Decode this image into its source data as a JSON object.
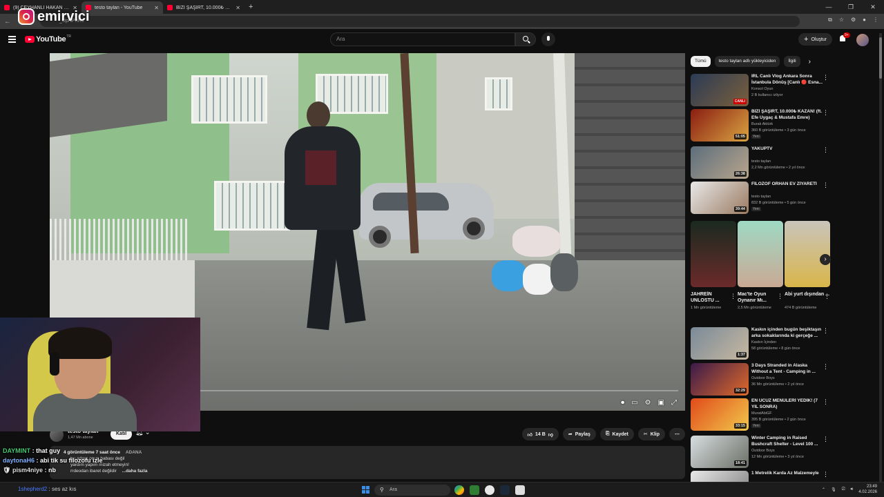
{
  "browser": {
    "tabs": [
      {
        "title": "(9) CEYHANLI HAKAN EV Z"
      },
      {
        "title": "testo taylan - YouTube"
      },
      {
        "title": "BİZİ ŞAŞIRT, 10.000₺ KAZANI"
      }
    ],
    "url": "_UpNPhR0"
  },
  "overlay": {
    "brand": "emirvici"
  },
  "youtube": {
    "logo_text": "YouTube",
    "logo_region": "TR",
    "search_placeholder": "Ara",
    "create_label": "Oluştur",
    "notif_badge": "9+"
  },
  "video": {
    "channel": "testo taylan",
    "subs": "1,47 Mn abone",
    "join": "Katıl",
    "likes": "14 B",
    "share": "Paylaş",
    "save": "Kaydet",
    "clip": "Klip",
    "description": {
      "views": "4 görüntüleme",
      "ago": "7 saat önce",
      "location": "ADANA",
      "line1": "bu adam onun babası değil",
      "line2": "yardım yapım mizah etmeyin!",
      "line3": "rrdeodan ibaret değildir",
      "more": "...daha fazla"
    }
  },
  "chat": [
    {
      "user": "DAYMINT",
      "text": "that guy"
    },
    {
      "user": "daytonaH6",
      "text": "abi tik su filozofu izle"
    },
    {
      "user": "pism4niye",
      "text": "nb"
    }
  ],
  "chat_last": {
    "user": "1shepherd2",
    "text": "ses az kıs"
  },
  "sidebar": {
    "chips": [
      "Tümü",
      "testo taylan adlı yükleyiciden",
      "İlgili"
    ],
    "recs": [
      {
        "title": "IRL Canlı Vlog Ankara Sonra İstanbula Dönüş [Canlı 🔴 Esna...",
        "channel": "Konsol Oyun",
        "views": "2 B kullanıcı izliyor",
        "badge": "CANLI",
        "isnew": ""
      },
      {
        "title": "BİZİ ŞAŞIRT, 10.000₺ KAZAN! (ft. Efe Uygaç & Mustafa Emre)",
        "channel": "Burak Aktürk",
        "views": "360 B görüntüleme • 3 gün önce",
        "badge": "51:05",
        "isnew": "Yeni"
      },
      {
        "title": "YAKUPTV",
        "channel": "testo taylan",
        "views": "2,2 Mn görüntüleme • 2 yıl önce",
        "badge": "26:38",
        "isnew": ""
      },
      {
        "title": "FİLOZOF ORHAN EV ZİYARETİ",
        "channel": "testo taylan",
        "views": "832 B görüntüleme • 5 gün önce",
        "badge": "39:44",
        "isnew": "Yeni"
      },
      {
        "title": "Kaskın içinden bugün beşiktaşın arka sokaklarında ki gerçeğe ...",
        "channel": "Kaskın İçinden",
        "views": "58 görüntüleme • 8 gün önce",
        "badge": "1:37",
        "isnew": ""
      },
      {
        "title": "3 Days Stranded in Alaska Without a Tent - Camping in ...",
        "channel": "Outdoor Boys",
        "views": "36 Mn görüntüleme • 2 yıl önce",
        "badge": "32:29",
        "isnew": ""
      },
      {
        "title": "EN UCUZ MENÜLERİ YEDİK! (7 YIL SONRA)",
        "channel": "MuratAbiGF",
        "views": "395 B görüntüleme • 2 gün önce",
        "badge": "33:15",
        "isnew": "Yeni"
      },
      {
        "title": "Winter Camping in Raised Bushcraft Shelter - Level 100 ...",
        "channel": "Outdoor Boys",
        "views": "12 Mn görüntüleme • 3 yıl önce",
        "badge": "18:41",
        "isnew": ""
      },
      {
        "title": "1 Metrelik Karda Az Malzemeyle",
        "channel": "",
        "views": "",
        "badge": "",
        "isnew": ""
      }
    ],
    "shorts": [
      {
        "title": "JAHREİN UNLOSTU ...",
        "views": "1 Mn görüntüleme"
      },
      {
        "title": "Mac'te Oyun Oynanır Mı...",
        "views": "2,5 Mn görüntüleme"
      },
      {
        "title": "Abi yurt dışından ...",
        "views": "474 B görüntüleme"
      }
    ]
  },
  "taskbar": {
    "search": "Ara",
    "time": "23:49",
    "date": "4.02.2026"
  },
  "colors": {
    "bg": "#0f0f0f",
    "accent": "#ff0033",
    "chip_active": "#f1f1f1"
  }
}
